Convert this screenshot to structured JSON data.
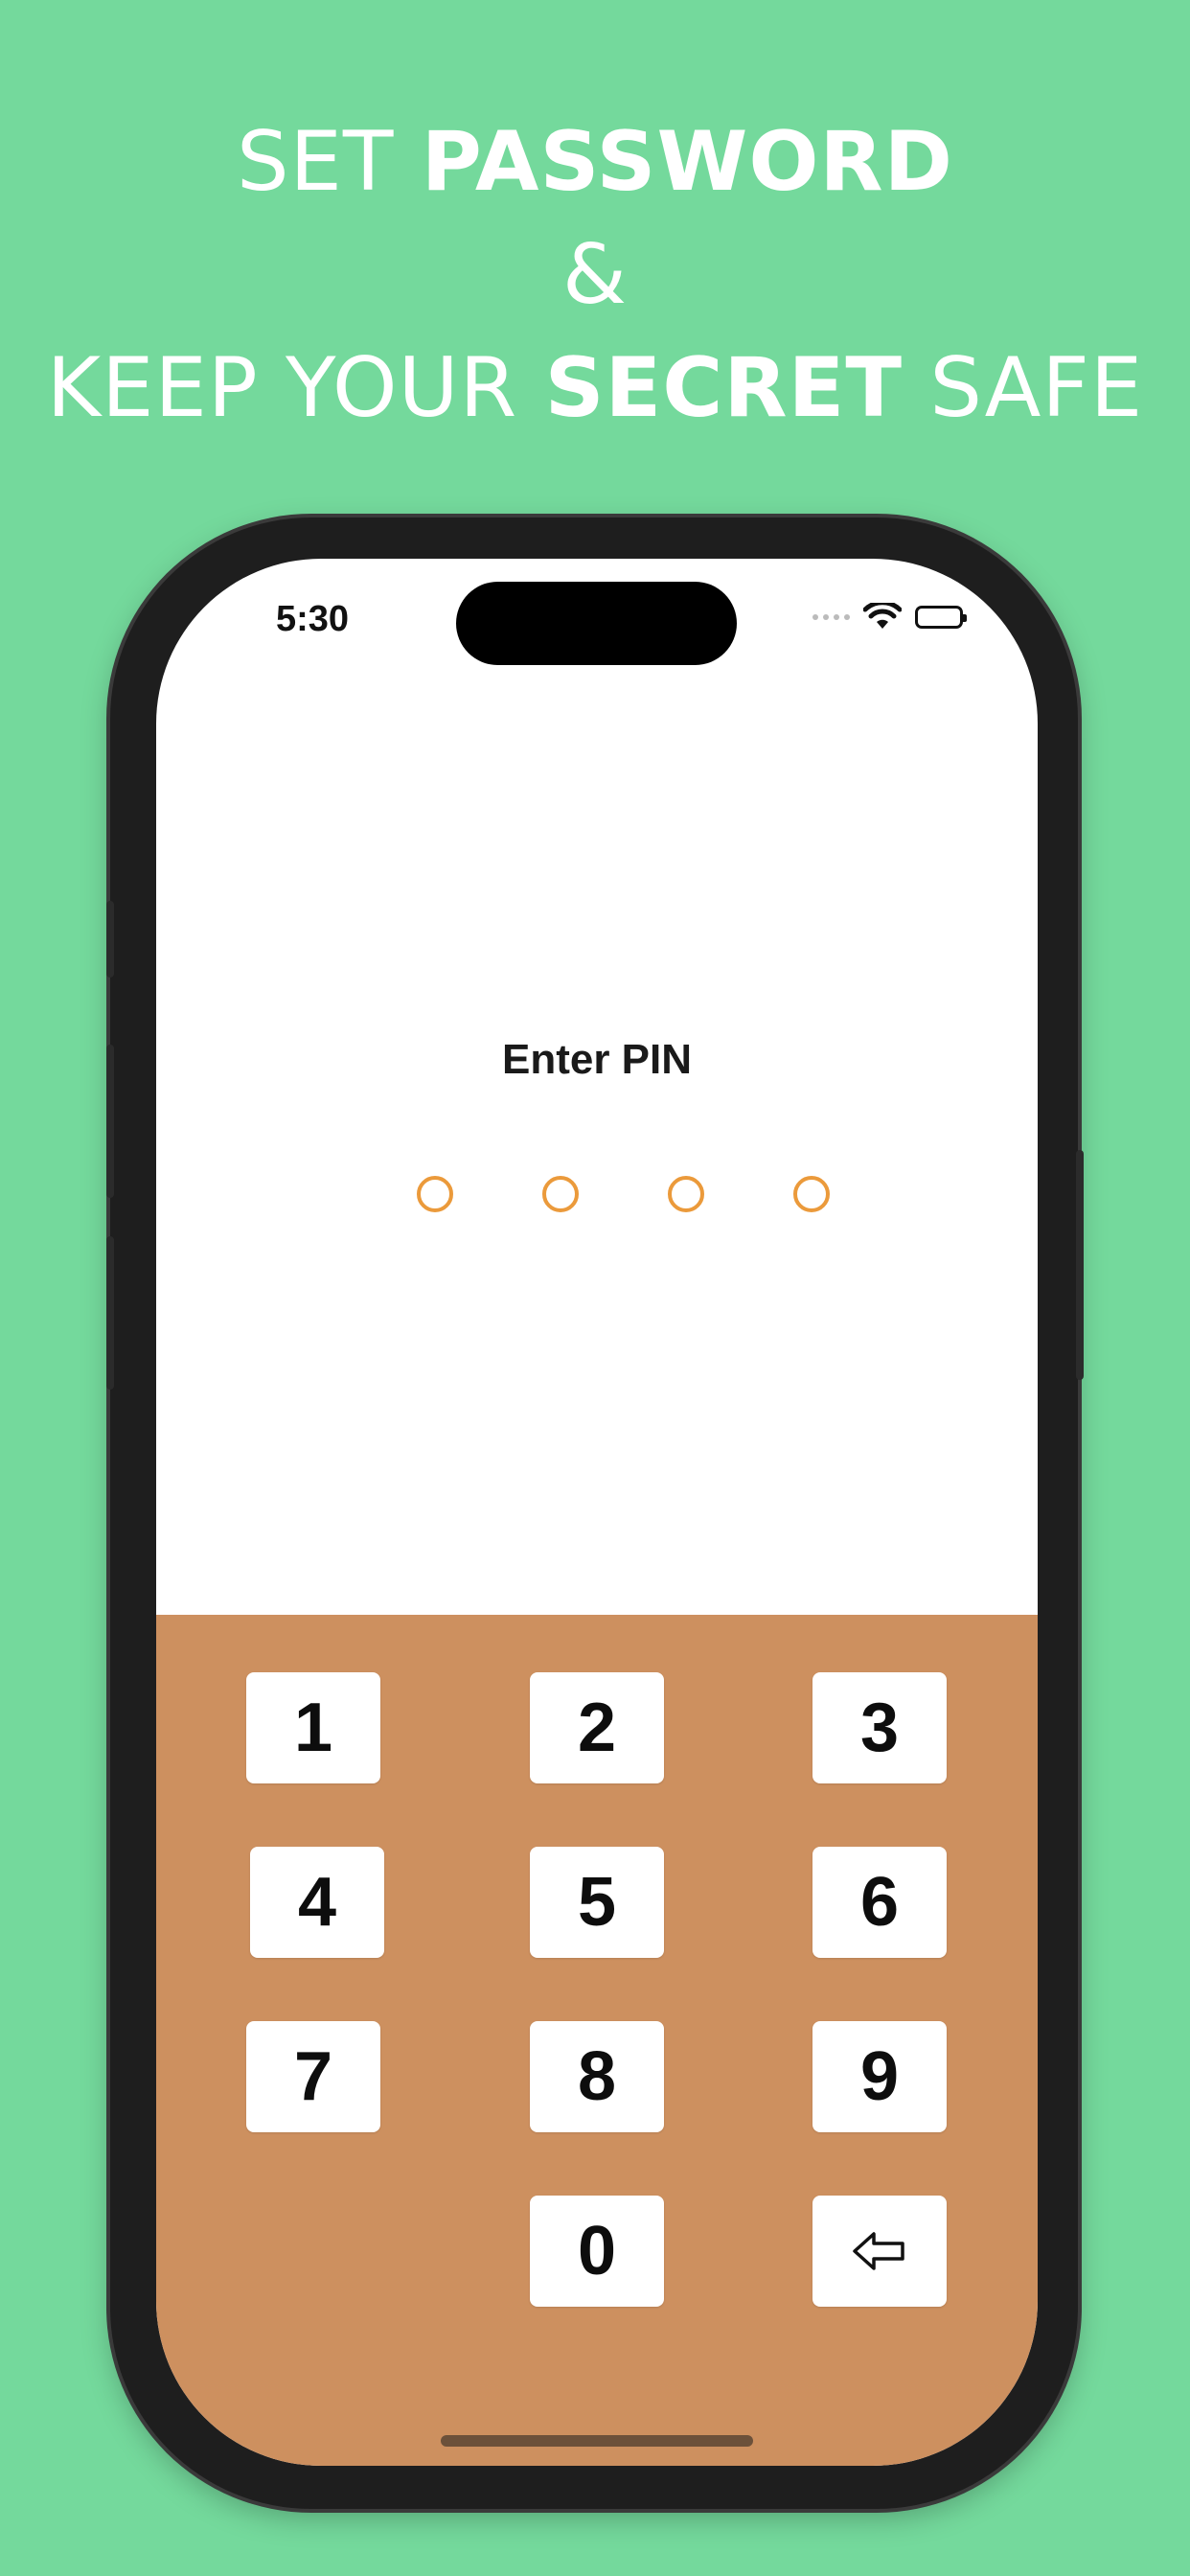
{
  "headline": {
    "line1_light": "SET ",
    "line1_bold": "PASSWORD",
    "line2": "&",
    "line3_light_a": "KEEP YOUR ",
    "line3_bold": "SECRET",
    "line3_light_b": " SAFE"
  },
  "colors": {
    "background": "#74d99c",
    "keypad": "#cd905f",
    "pin_dot": "#eb9a3b",
    "key": "#ffffff"
  },
  "status_bar": {
    "time": "5:30",
    "icons": [
      "signal-dots-icon",
      "wifi-icon",
      "battery-icon"
    ]
  },
  "pin_screen": {
    "title": "Enter PIN",
    "pin_length": 4,
    "entered": 0
  },
  "keypad": {
    "keys": [
      "1",
      "2",
      "3",
      "4",
      "5",
      "6",
      "7",
      "8",
      "9",
      "0"
    ],
    "backspace_icon": "backspace-arrow-icon"
  }
}
